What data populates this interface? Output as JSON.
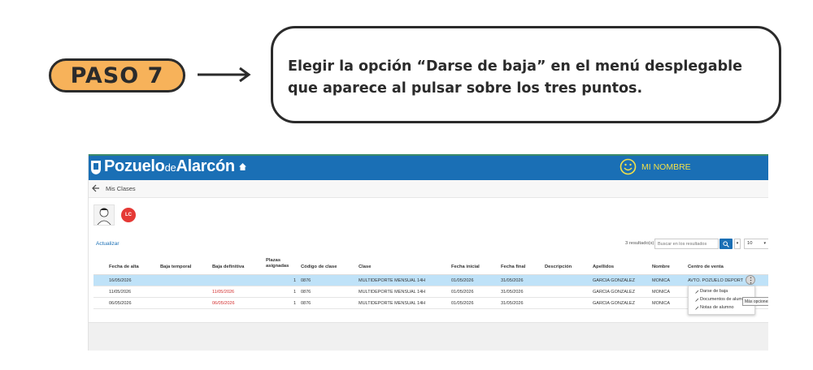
{
  "step": {
    "label": "PASO 7"
  },
  "instruction": {
    "line1": "Elegir la opción “Darse de baja” en el menú desplegable",
    "line2": "que aparece al pulsar sobre los tres puntos."
  },
  "app": {
    "logo_main": "Pozuelo",
    "logo_de": "de",
    "logo_tail": "Alarcón",
    "user_name": "MI NOMBRE",
    "breadcrumb": "Mis Clases",
    "badge_initials": "LC",
    "refresh_label": "Actualizar",
    "results_count": "3 resultado(s)",
    "search_placeholder": "Buscar en los resultados",
    "page_size": "10"
  },
  "table": {
    "headers": [
      "Fecha de alta",
      "Baja temporal",
      "Baja definitiva",
      "Plazas asignadas",
      "Código de clase",
      "Clase",
      "Fecha inicial",
      "Fecha final",
      "Descripción",
      "Apellidos",
      "Nombre",
      "Centro de venta"
    ],
    "rows": [
      {
        "alta": "16/05/2026",
        "temporal": "",
        "definitiva": "",
        "plazas": "1",
        "codigo": "0876",
        "clase": "MULTIDEPORTE MENSUAL 14H",
        "inicial": "01/05/2026",
        "final": "31/05/2026",
        "desc": "",
        "apellidos": "GARCIA GONZALEZ",
        "nombre": "MONICA",
        "centro": "AVTO. POZUELO DEPORT"
      },
      {
        "alta": "11/05/2026",
        "temporal": "",
        "definitiva": "11/05/2026",
        "plazas": "1",
        "codigo": "0876",
        "clase": "MULTIDEPORTE MENSUAL 14H",
        "inicial": "01/05/2026",
        "final": "31/05/2026",
        "desc": "",
        "apellidos": "GARCIA GONZALEZ",
        "nombre": "MONICA",
        "centro": ""
      },
      {
        "alta": "06/05/2026",
        "temporal": "",
        "definitiva": "06/05/2026",
        "plazas": "1",
        "codigo": "0876",
        "clase": "MULTIDEPORTE MENSUAL 14H",
        "inicial": "01/05/2026",
        "final": "31/05/2026",
        "desc": "",
        "apellidos": "GARCIA GONZALEZ",
        "nombre": "MONICA",
        "centro": ""
      }
    ]
  },
  "menu": {
    "items": [
      "Darse de baja",
      "Documentos de alumno",
      "Notas de alumno"
    ],
    "tooltip": "Más opciones"
  },
  "colors": {
    "accent": "#1a6fb5",
    "pill": "#f7b25a",
    "selected_row": "#bfe2f8",
    "danger": "#d32f2f"
  }
}
